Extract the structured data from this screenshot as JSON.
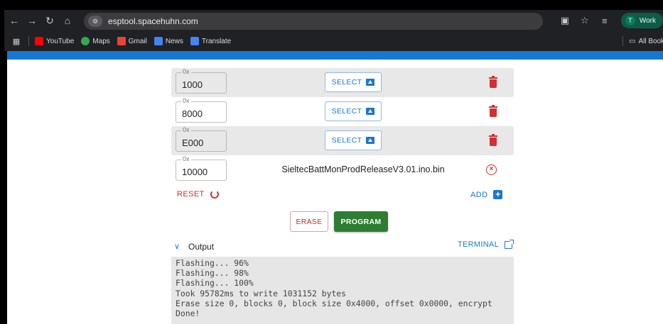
{
  "browser": {
    "url": "esptool.spacehuhn.com",
    "profile_label": "Work",
    "profile_initial": "T",
    "bookmarks": [
      {
        "label": "YouTube",
        "color": "#ff0000"
      },
      {
        "label": "Maps",
        "color": "#34a853"
      },
      {
        "label": "Gmail",
        "color": "#ea4335"
      },
      {
        "label": "News",
        "color": "#4285f4"
      },
      {
        "label": "Translate",
        "color": "#4285f4"
      }
    ],
    "all_bookmarks_label": "All Bookmar"
  },
  "rows": [
    {
      "prefix": "0x",
      "offset": "1000",
      "action": "SELECT"
    },
    {
      "prefix": "0x",
      "offset": "8000",
      "action": "SELECT"
    },
    {
      "prefix": "0x",
      "offset": "E000",
      "action": "SELECT"
    },
    {
      "prefix": "0x",
      "offset": "10000",
      "filename": "SieltecBattMonProdReleaseV3.01.ino.bin"
    }
  ],
  "controls": {
    "reset_label": "RESET",
    "add_label": "ADD",
    "erase_label": "ERASE",
    "program_label": "PROGRAM"
  },
  "output": {
    "title": "Output",
    "terminal_label": "TERMINAL",
    "lines": [
      "Flashing... 96%",
      "Flashing... 98%",
      "Flashing... 100%",
      "Took 95782ms to write 1031152 bytes",
      "Erase size 0, blocks 0, block size 0x4000, offset 0x0000, encrypt",
      "Done!"
    ]
  },
  "colors": {
    "accent": "#1976d2",
    "danger": "#d32f2f",
    "program": "#2e7d32"
  }
}
